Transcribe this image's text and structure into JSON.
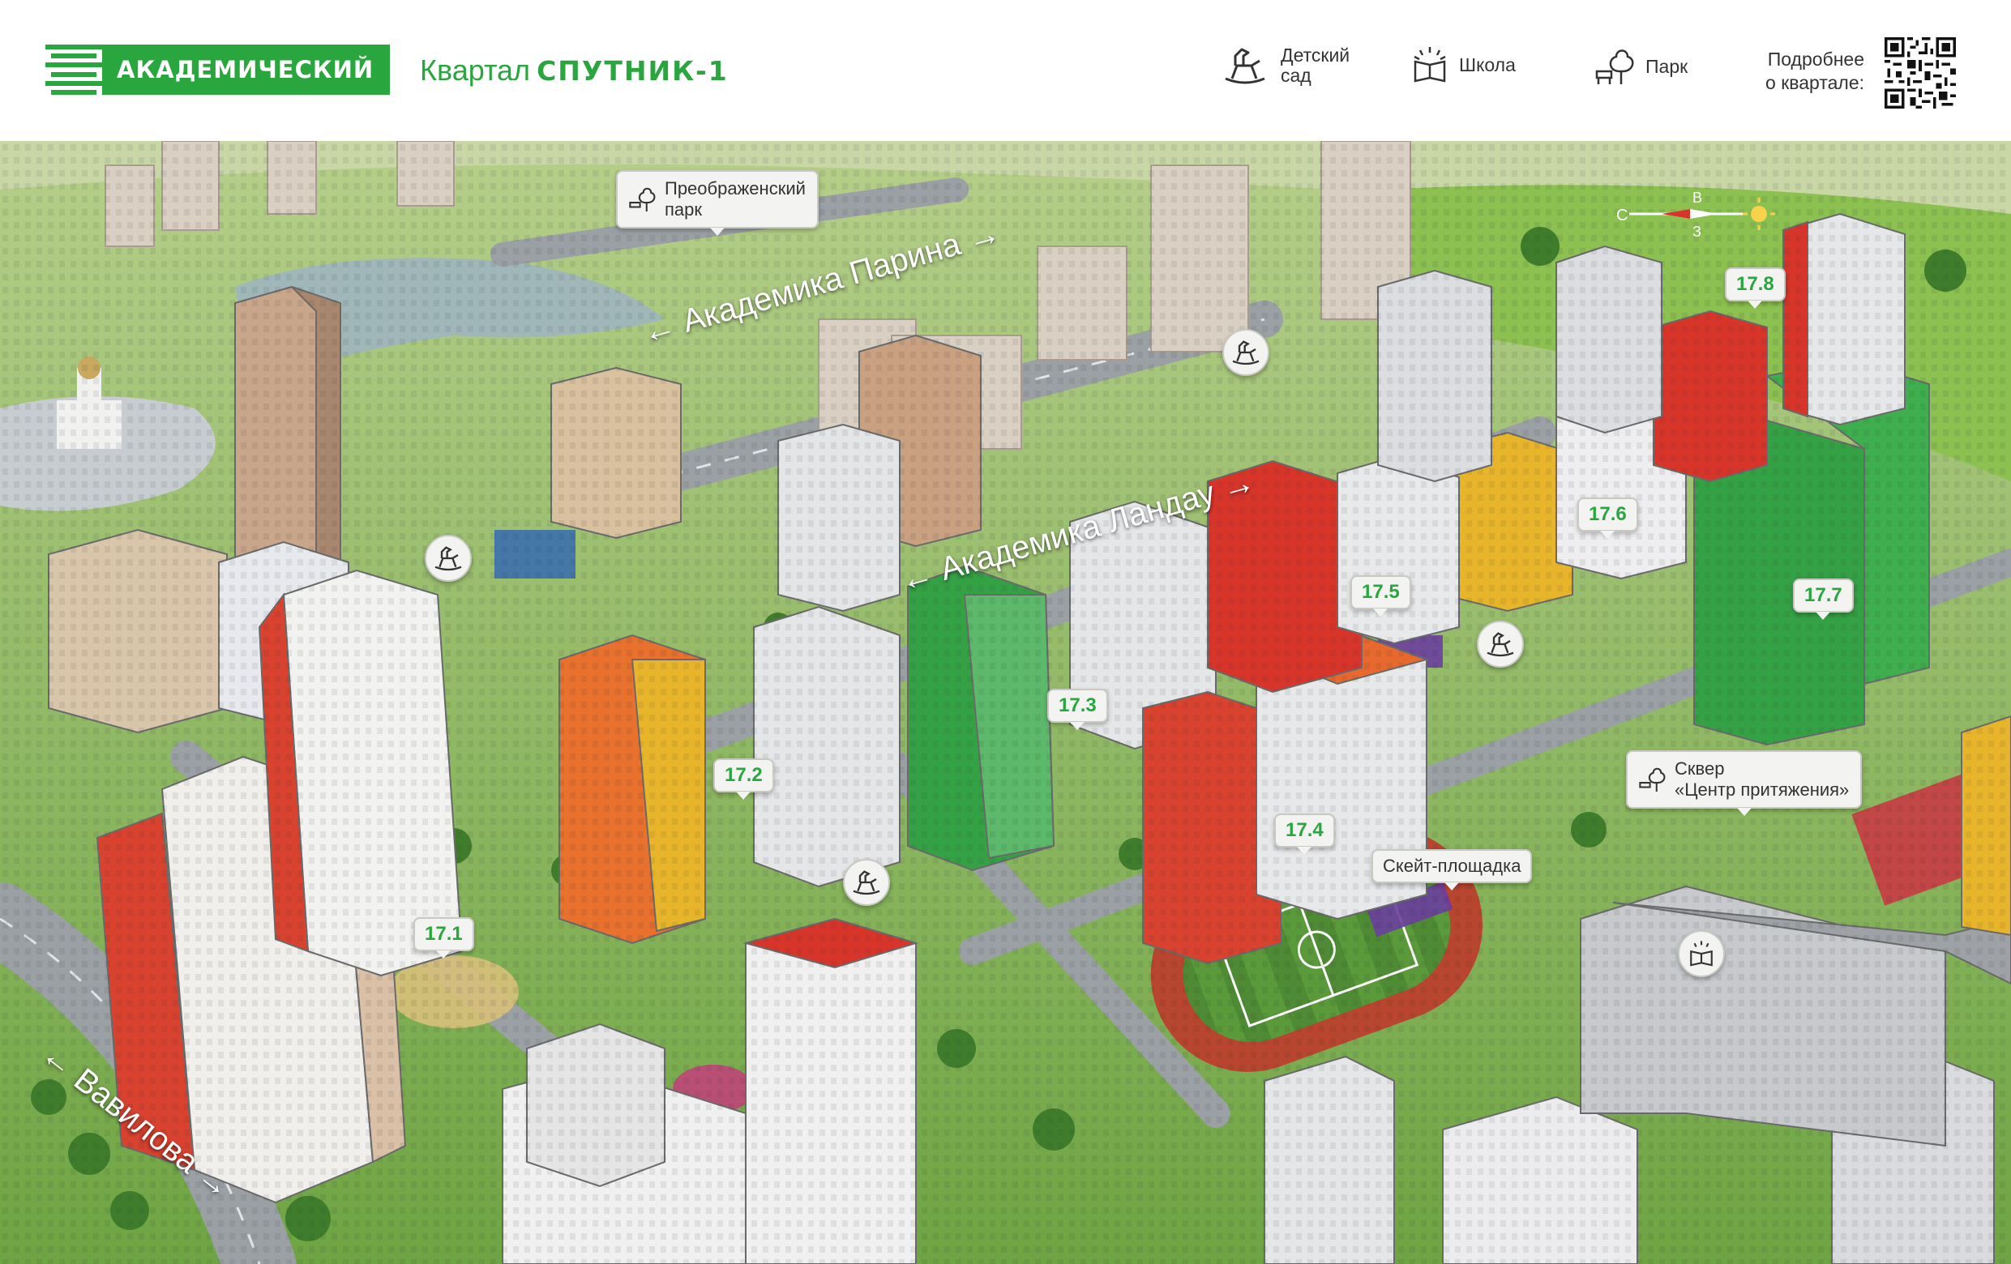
{
  "header": {
    "logo_text": "АКАДЕМИЧЕСКИЙ",
    "quarter_prefix": "Квартал",
    "quarter_name": "СПУТНИК-1",
    "legend": {
      "kindergarten_line1": "Детский",
      "kindergarten_line2": "сад",
      "school": "Школа",
      "park": "Парк"
    },
    "more_line1": "Подробнее",
    "more_line2": "о квартале:"
  },
  "map": {
    "buildings": {
      "b17_1": "17.1",
      "b17_2": "17.2",
      "b17_3": "17.3",
      "b17_4": "17.4",
      "b17_5": "17.5",
      "b17_6": "17.6",
      "b17_7": "17.7",
      "b17_8": "17.8"
    },
    "places": {
      "park_line1": "Преображенский",
      "park_line2": "парк",
      "square_line1": "Сквер",
      "square_line2": "«Центр притяжения»",
      "skate": "Скейт-площадка"
    },
    "streets": {
      "parina": "← Академика Парина →",
      "landau": "← Академика Ландау →",
      "vavilova": "← Вавилова →"
    },
    "compass": {
      "north": "С",
      "west": "В",
      "south": "З"
    }
  },
  "colors": {
    "brand_green": "#2aa63e",
    "building_red": "#d8352a",
    "building_orange": "#e8692e",
    "building_yellow": "#e8b42a",
    "building_green": "#2f9e44",
    "grass": "#6aa83e"
  }
}
